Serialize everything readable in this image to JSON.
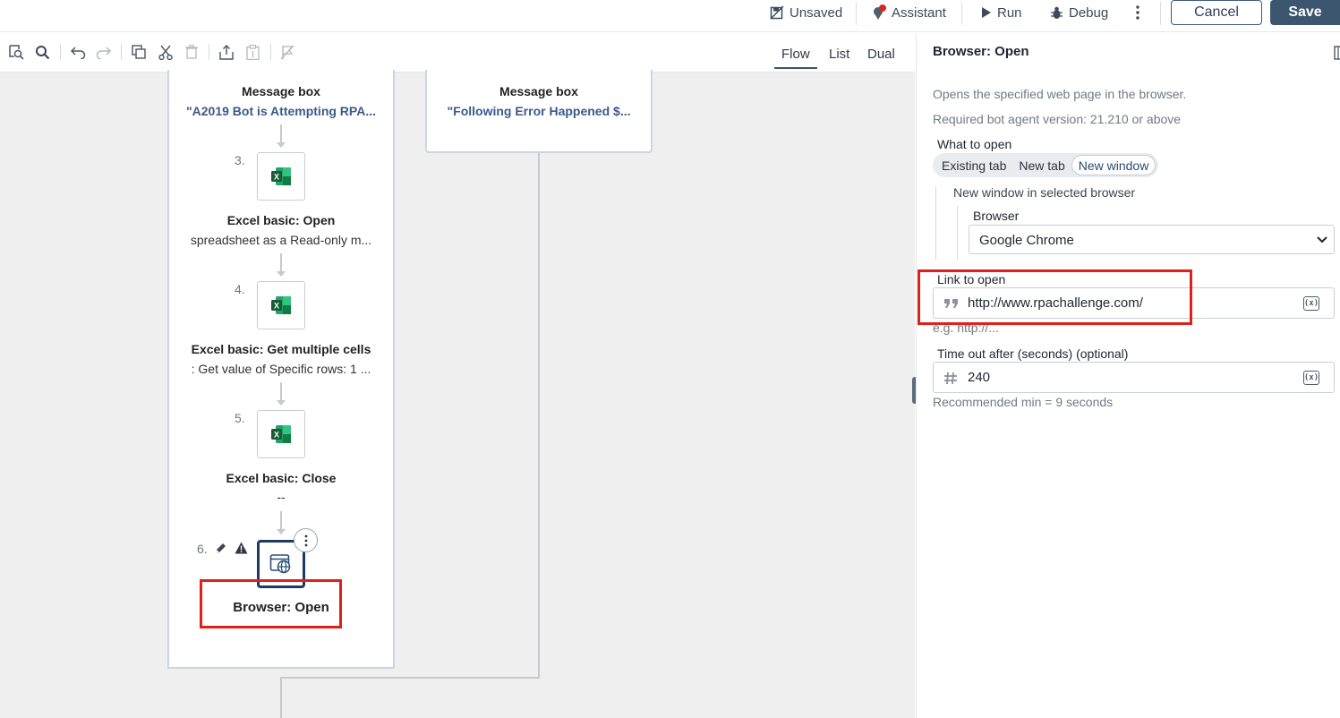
{
  "topbar": {
    "unsaved": "Unsaved",
    "assistant": "Assistant",
    "run": "Run",
    "debug": "Debug",
    "cancel": "Cancel",
    "save": "Save"
  },
  "views": {
    "flow": "Flow",
    "list": "List",
    "dual": "Dual",
    "active": "Flow"
  },
  "flow": {
    "left_lane": {
      "message_box": {
        "title": "Message box",
        "subtitle": "\"A2019 Bot is Attempting RPA..."
      },
      "steps": [
        {
          "num": "3.",
          "title": "Excel basic: Open",
          "subtitle": "spreadsheet as a Read-only m..."
        },
        {
          "num": "4.",
          "title": "Excel basic: Get multiple cells",
          "subtitle": ": Get value of Specific rows: 1 ..."
        },
        {
          "num": "5.",
          "title": "Excel basic: Close",
          "subtitle": "--"
        },
        {
          "num": "6.",
          "title": "Browser: Open",
          "subtitle": ""
        }
      ]
    },
    "right_lane": {
      "message_box": {
        "title": "Message box",
        "subtitle": "\"Following Error Happened $..."
      }
    }
  },
  "panel": {
    "title": "Browser: Open",
    "description": "Opens the specified web page in the browser.",
    "required_version": "Required bot agent version: 21.210 or above",
    "what_to_open": {
      "label": "What to open",
      "options": [
        "Existing tab",
        "New tab",
        "New window"
      ],
      "selected": "New window"
    },
    "new_window_caption": "New window in selected browser",
    "browser": {
      "label": "Browser",
      "value": "Google Chrome"
    },
    "link": {
      "label": "Link to open",
      "value": "http://www.rpachallenge.com/",
      "hint": "e.g. http://..."
    },
    "timeout": {
      "label": "Time out after (seconds) (optional)",
      "value": "240",
      "hint": "Recommended min = 9 seconds"
    },
    "variable_button": "(x)"
  },
  "colors": {
    "accent": "#3d5670",
    "highlight": "#e0201a",
    "excel_green": "#1d7044",
    "canvas": "#efefef"
  }
}
